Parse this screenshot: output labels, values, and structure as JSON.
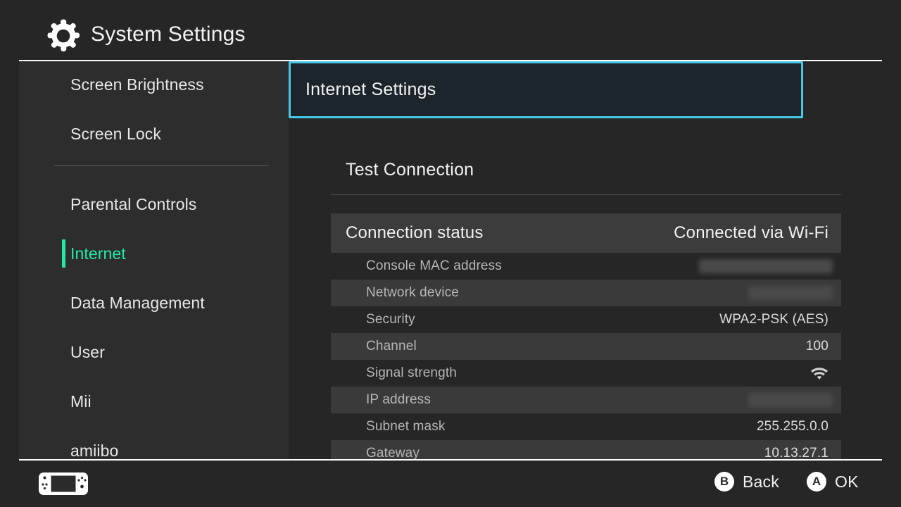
{
  "header": {
    "title": "System Settings",
    "icon": "gear-icon"
  },
  "sidebar": {
    "items": [
      {
        "label": "Screen Brightness",
        "active": false
      },
      {
        "label": "Screen Lock",
        "active": false
      },
      {
        "label": "Parental Controls",
        "active": false
      },
      {
        "label": "Internet",
        "active": true
      },
      {
        "label": "Data Management",
        "active": false
      },
      {
        "label": "User",
        "active": false
      },
      {
        "label": "Mii",
        "active": false
      },
      {
        "label": "amiibo",
        "active": false
      }
    ],
    "active_color": "#25e8a8"
  },
  "main": {
    "menu": {
      "internet_settings": "Internet Settings",
      "test_connection": "Test Connection",
      "selection_border_color": "#48c8e8"
    },
    "connection_status": {
      "key": "Connection status",
      "value": "Connected via Wi-Fi"
    },
    "details": [
      {
        "key": "Console MAC address",
        "value": "",
        "redacted": true,
        "wide": true,
        "icon": ""
      },
      {
        "key": "Network device",
        "value": "",
        "redacted": true,
        "wide": false,
        "icon": ""
      },
      {
        "key": "Security",
        "value": "WPA2-PSK (AES)",
        "redacted": false,
        "wide": false,
        "icon": ""
      },
      {
        "key": "Channel",
        "value": "100",
        "redacted": false,
        "wide": false,
        "icon": ""
      },
      {
        "key": "Signal strength",
        "value": "",
        "redacted": false,
        "wide": false,
        "icon": "wifi-icon"
      },
      {
        "key": "IP address",
        "value": "",
        "redacted": true,
        "wide": false,
        "icon": ""
      },
      {
        "key": "Subnet mask",
        "value": "255.255.0.0",
        "redacted": false,
        "wide": false,
        "icon": ""
      },
      {
        "key": "Gateway",
        "value": "10.13.27.1",
        "redacted": false,
        "wide": false,
        "icon": ""
      }
    ]
  },
  "footer": {
    "controller_icon": "switch-console-icon",
    "hints": [
      {
        "badge": "B",
        "label": "Back"
      },
      {
        "badge": "A",
        "label": "OK"
      }
    ]
  }
}
